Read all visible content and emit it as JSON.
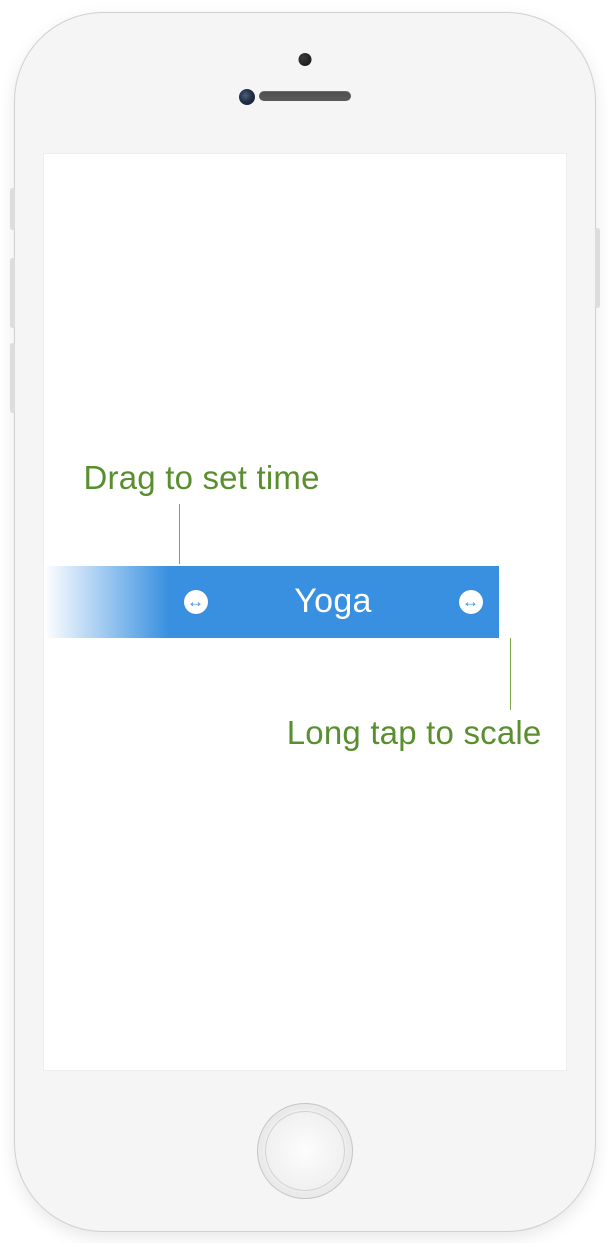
{
  "hints": {
    "drag": "Drag to set time",
    "scale": "Long tap to scale"
  },
  "event": {
    "title": "Yoga"
  },
  "glyphs": {
    "resize": "↔"
  },
  "colors": {
    "accent": "#3a90e0",
    "hint": "#5a8f2f"
  }
}
